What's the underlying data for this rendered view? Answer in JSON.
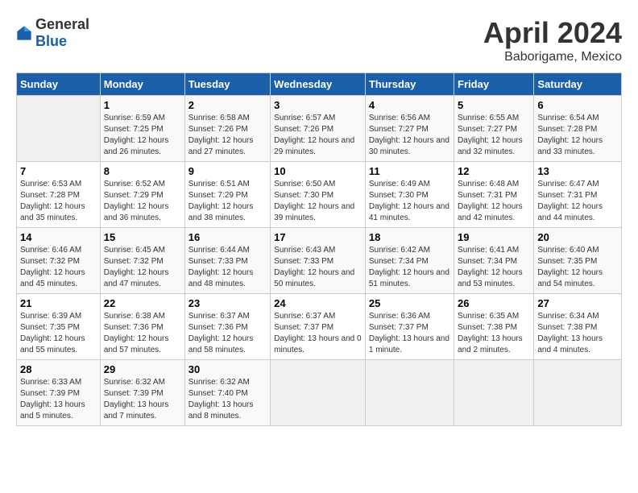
{
  "logo": {
    "general": "General",
    "blue": "Blue"
  },
  "title": {
    "month": "April 2024",
    "location": "Baborigame, Mexico"
  },
  "weekdays": [
    "Sunday",
    "Monday",
    "Tuesday",
    "Wednesday",
    "Thursday",
    "Friday",
    "Saturday"
  ],
  "weeks": [
    [
      {
        "day": "",
        "empty": true
      },
      {
        "day": "1",
        "sunrise": "6:59 AM",
        "sunset": "7:25 PM",
        "daylight": "12 hours and 26 minutes."
      },
      {
        "day": "2",
        "sunrise": "6:58 AM",
        "sunset": "7:26 PM",
        "daylight": "12 hours and 27 minutes."
      },
      {
        "day": "3",
        "sunrise": "6:57 AM",
        "sunset": "7:26 PM",
        "daylight": "12 hours and 29 minutes."
      },
      {
        "day": "4",
        "sunrise": "6:56 AM",
        "sunset": "7:27 PM",
        "daylight": "12 hours and 30 minutes."
      },
      {
        "day": "5",
        "sunrise": "6:55 AM",
        "sunset": "7:27 PM",
        "daylight": "12 hours and 32 minutes."
      },
      {
        "day": "6",
        "sunrise": "6:54 AM",
        "sunset": "7:28 PM",
        "daylight": "12 hours and 33 minutes."
      }
    ],
    [
      {
        "day": "7",
        "sunrise": "6:53 AM",
        "sunset": "7:28 PM",
        "daylight": "12 hours and 35 minutes."
      },
      {
        "day": "8",
        "sunrise": "6:52 AM",
        "sunset": "7:29 PM",
        "daylight": "12 hours and 36 minutes."
      },
      {
        "day": "9",
        "sunrise": "6:51 AM",
        "sunset": "7:29 PM",
        "daylight": "12 hours and 38 minutes."
      },
      {
        "day": "10",
        "sunrise": "6:50 AM",
        "sunset": "7:30 PM",
        "daylight": "12 hours and 39 minutes."
      },
      {
        "day": "11",
        "sunrise": "6:49 AM",
        "sunset": "7:30 PM",
        "daylight": "12 hours and 41 minutes."
      },
      {
        "day": "12",
        "sunrise": "6:48 AM",
        "sunset": "7:31 PM",
        "daylight": "12 hours and 42 minutes."
      },
      {
        "day": "13",
        "sunrise": "6:47 AM",
        "sunset": "7:31 PM",
        "daylight": "12 hours and 44 minutes."
      }
    ],
    [
      {
        "day": "14",
        "sunrise": "6:46 AM",
        "sunset": "7:32 PM",
        "daylight": "12 hours and 45 minutes."
      },
      {
        "day": "15",
        "sunrise": "6:45 AM",
        "sunset": "7:32 PM",
        "daylight": "12 hours and 47 minutes."
      },
      {
        "day": "16",
        "sunrise": "6:44 AM",
        "sunset": "7:33 PM",
        "daylight": "12 hours and 48 minutes."
      },
      {
        "day": "17",
        "sunrise": "6:43 AM",
        "sunset": "7:33 PM",
        "daylight": "12 hours and 50 minutes."
      },
      {
        "day": "18",
        "sunrise": "6:42 AM",
        "sunset": "7:34 PM",
        "daylight": "12 hours and 51 minutes."
      },
      {
        "day": "19",
        "sunrise": "6:41 AM",
        "sunset": "7:34 PM",
        "daylight": "12 hours and 53 minutes."
      },
      {
        "day": "20",
        "sunrise": "6:40 AM",
        "sunset": "7:35 PM",
        "daylight": "12 hours and 54 minutes."
      }
    ],
    [
      {
        "day": "21",
        "sunrise": "6:39 AM",
        "sunset": "7:35 PM",
        "daylight": "12 hours and 55 minutes."
      },
      {
        "day": "22",
        "sunrise": "6:38 AM",
        "sunset": "7:36 PM",
        "daylight": "12 hours and 57 minutes."
      },
      {
        "day": "23",
        "sunrise": "6:37 AM",
        "sunset": "7:36 PM",
        "daylight": "12 hours and 58 minutes."
      },
      {
        "day": "24",
        "sunrise": "6:37 AM",
        "sunset": "7:37 PM",
        "daylight": "13 hours and 0 minutes."
      },
      {
        "day": "25",
        "sunrise": "6:36 AM",
        "sunset": "7:37 PM",
        "daylight": "13 hours and 1 minute."
      },
      {
        "day": "26",
        "sunrise": "6:35 AM",
        "sunset": "7:38 PM",
        "daylight": "13 hours and 2 minutes."
      },
      {
        "day": "27",
        "sunrise": "6:34 AM",
        "sunset": "7:38 PM",
        "daylight": "13 hours and 4 minutes."
      }
    ],
    [
      {
        "day": "28",
        "sunrise": "6:33 AM",
        "sunset": "7:39 PM",
        "daylight": "13 hours and 5 minutes."
      },
      {
        "day": "29",
        "sunrise": "6:32 AM",
        "sunset": "7:39 PM",
        "daylight": "13 hours and 7 minutes."
      },
      {
        "day": "30",
        "sunrise": "6:32 AM",
        "sunset": "7:40 PM",
        "daylight": "13 hours and 8 minutes."
      },
      {
        "day": "",
        "empty": true
      },
      {
        "day": "",
        "empty": true
      },
      {
        "day": "",
        "empty": true
      },
      {
        "day": "",
        "empty": true
      }
    ]
  ],
  "labels": {
    "sunrise": "Sunrise:",
    "sunset": "Sunset:",
    "daylight": "Daylight:"
  }
}
